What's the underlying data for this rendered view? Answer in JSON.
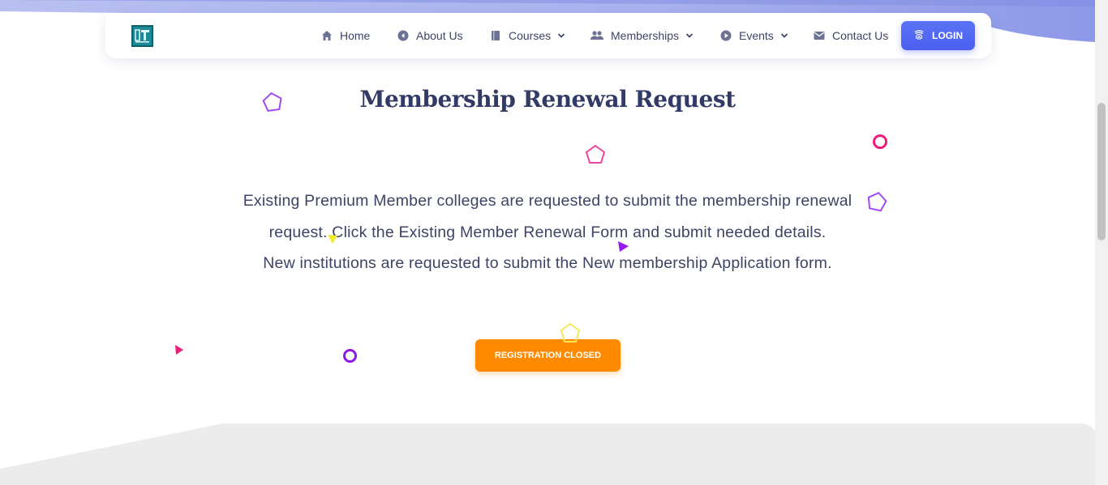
{
  "nav": {
    "home": "Home",
    "about": "About Us",
    "courses": "Courses",
    "memberships": "Memberships",
    "events": "Events",
    "contact": "Contact Us",
    "login": "LOGIN"
  },
  "main": {
    "title": "Membership Renewal Request",
    "paragraph_line1": "Existing Premium Member colleges are requested to submit the membership renewal",
    "paragraph_line2": "request. Click the Existing Member Renewal Form and submit needed details.",
    "paragraph_line3": "New institutions are requested to submit the New membership Application form.",
    "button": "REGISTRATION CLOSED"
  },
  "colors": {
    "primary": "#4a5ff0",
    "accent": "#ff8a00",
    "heading": "#323b66",
    "text": "#3d4465"
  },
  "icons": [
    "home-icon",
    "info-icon",
    "book-icon",
    "people-icon",
    "event-icon",
    "mail-icon",
    "fingerprint-icon",
    "chevron-down-icon"
  ]
}
